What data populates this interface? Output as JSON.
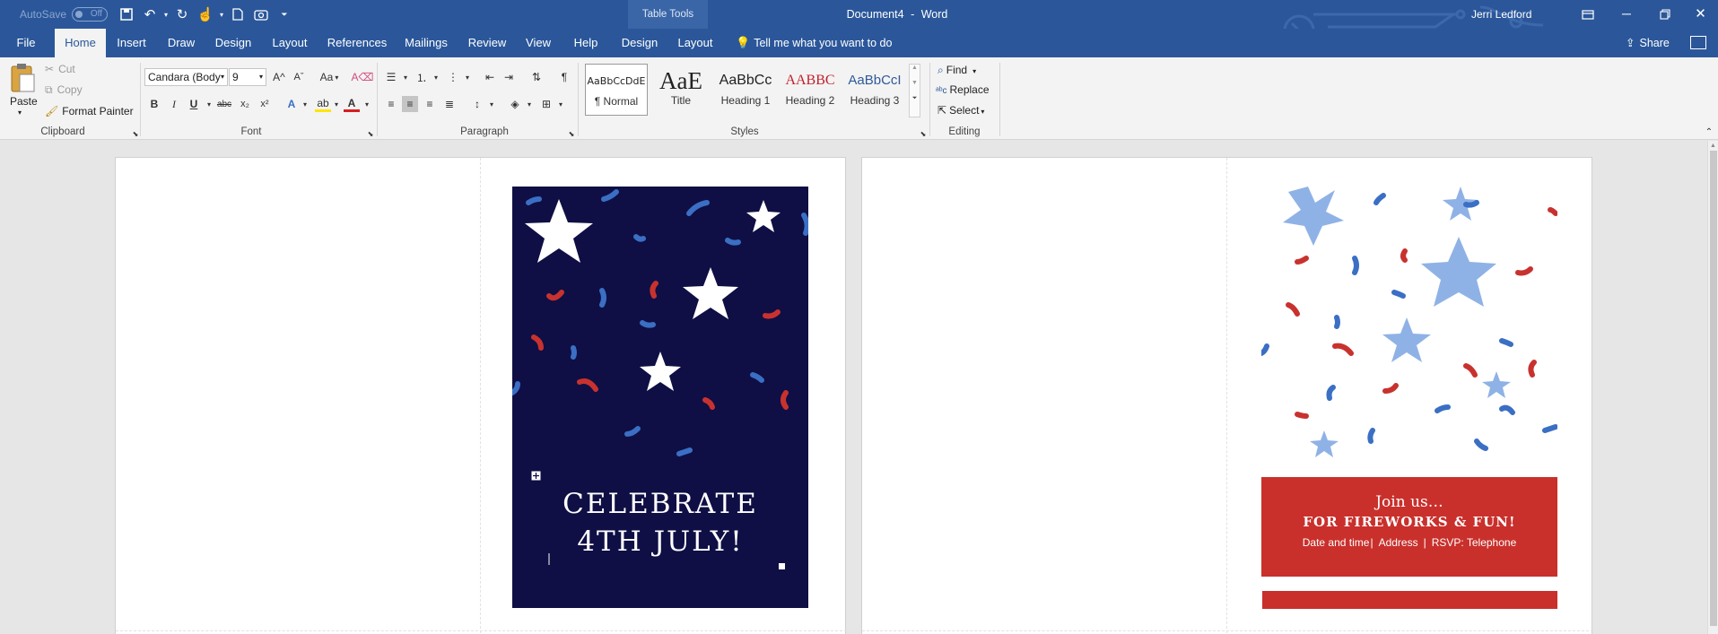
{
  "window": {
    "doc_title": "Document4",
    "app_name": "Word",
    "separator": "-",
    "contextual_group": "Table Tools",
    "user": "Jerri Ledford"
  },
  "qat": {
    "autosave_label": "AutoSave",
    "autosave_state": "Off"
  },
  "tabs": [
    {
      "label": "File"
    },
    {
      "label": "Home"
    },
    {
      "label": "Insert"
    },
    {
      "label": "Draw"
    },
    {
      "label": "Design"
    },
    {
      "label": "Layout"
    },
    {
      "label": "References"
    },
    {
      "label": "Mailings"
    },
    {
      "label": "Review"
    },
    {
      "label": "View"
    },
    {
      "label": "Help"
    },
    {
      "label": "Design"
    },
    {
      "label": "Layout"
    }
  ],
  "tell_me": "Tell me what you want to do",
  "share": "Share",
  "clipboard": {
    "paste": "Paste",
    "cut": "Cut",
    "copy": "Copy",
    "format_painter": "Format Painter",
    "label": "Clipboard"
  },
  "font": {
    "name": "Candara (Body",
    "size": "9",
    "label": "Font",
    "bold": "B",
    "italic": "I",
    "underline": "U",
    "strike": "abc",
    "sub": "x₂",
    "sup": "x²",
    "aa": "Aa",
    "grow": "A^",
    "shrink": "Aˇ"
  },
  "paragraph": {
    "label": "Paragraph"
  },
  "styles": {
    "label": "Styles",
    "items": [
      {
        "preview": "AaBbCcDdE",
        "name": "¶ Normal"
      },
      {
        "preview": "AaE",
        "name": "Title"
      },
      {
        "preview": "AaBbCc",
        "name": "Heading 1"
      },
      {
        "preview": "AABBC",
        "name": "Heading 2"
      },
      {
        "preview": "AaBbCcI",
        "name": "Heading 3"
      }
    ]
  },
  "editing": {
    "find": "Find",
    "replace": "Replace",
    "select": "Select",
    "label": "Editing"
  },
  "document": {
    "card_title_line1": "CELEBRATE",
    "card_title_line2": "4TH JULY!",
    "join_line": "Join us…",
    "fireworks_line": "FOR FIREWORKS & FUN!",
    "details_line": "Date and time",
    "address": "Address",
    "rsvp": "RSVP: Telephone"
  },
  "colors": {
    "ribbon_blue": "#2b579a",
    "navy": "#0f0f45",
    "red": "#c9302c",
    "confetti_blue": "#3a6fc4",
    "confetti_red": "#c8322e",
    "star_light": "#8fb2e6"
  }
}
